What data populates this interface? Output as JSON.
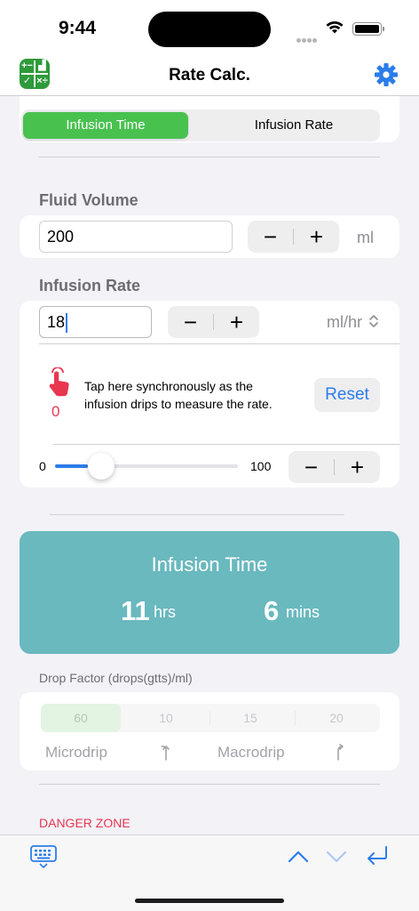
{
  "status": {
    "time": "9:44"
  },
  "nav": {
    "title": "Rate Calc."
  },
  "mode_segment": {
    "options": [
      "Infusion Time",
      "Infusion Rate"
    ],
    "selected": "Infusion Time"
  },
  "fluid_volume": {
    "label": "Fluid Volume",
    "value": "200",
    "unit": "ml"
  },
  "infusion_rate": {
    "label": "Infusion Rate",
    "value": "18",
    "unit": "ml/hr"
  },
  "stepper": {
    "minus": "−",
    "plus": "+"
  },
  "tap_counter": {
    "count": "0",
    "hint": "Tap here synchronously as the infusion drips to measure the rate.",
    "reset_label": "Reset"
  },
  "slider": {
    "min_label": "0",
    "max_label": "100",
    "value": 18,
    "min": 0,
    "max": 100
  },
  "result": {
    "title": "Infusion Time",
    "hours": "11",
    "hours_unit": "hrs",
    "minutes": "6",
    "minutes_unit": "mins"
  },
  "drop_factor": {
    "label": "Drop Factor (drops(gtts)/ml)",
    "options": [
      "60",
      "10",
      "15",
      "20"
    ],
    "selected": "60",
    "microdrip_label": "Microdrip",
    "macrodrip_label": "Macrodrip"
  },
  "danger_zone": {
    "label": "DANGER ZONE"
  },
  "colors": {
    "accent": "#2b7de9",
    "segment_active": "#49c14f",
    "result_bg": "#69b9bf",
    "danger": "#e8364f"
  }
}
